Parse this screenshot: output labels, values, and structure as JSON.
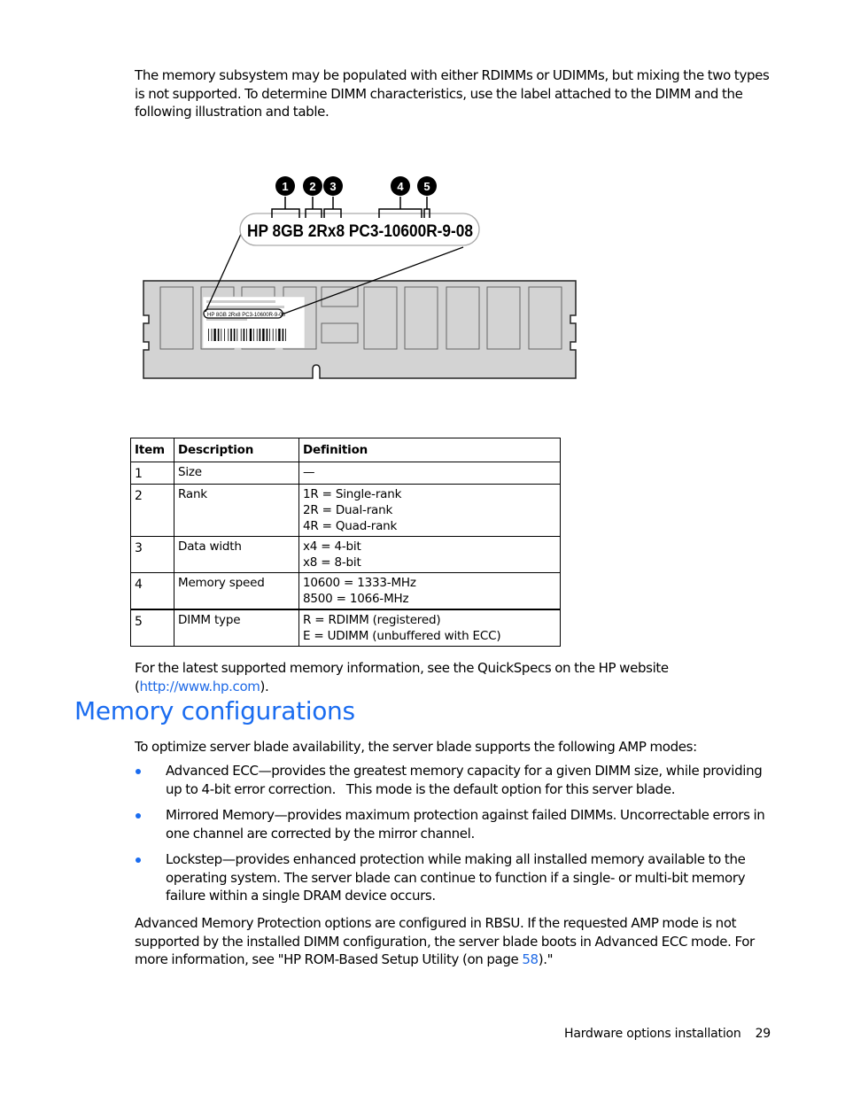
{
  "intro_paragraph": "The memory subsystem may be populated with either RDIMMs or UDIMMs, but mixing the two types is not supported. To determine DIMM characteristics, use the label attached to the DIMM and the following illustration and table.",
  "figure": {
    "label_text": "HP 8GB 2Rx8 PC3-10600R-9-08",
    "small_label_text": "HP 8GB 2Rx8 PC3-10600R-9-08",
    "callouts": [
      "1",
      "2",
      "3",
      "4",
      "5"
    ],
    "colors": {
      "module_fill": "#d3d3d3",
      "module_stroke": "#222222",
      "chip_stroke": "#666666",
      "callout_fill": "#000000",
      "callout_text": "#ffffff",
      "label_bubble_stroke": "#aaaaaa"
    }
  },
  "table": {
    "headers": [
      "Item",
      "Description",
      "Definition"
    ],
    "rows": [
      {
        "item": "1",
        "description": "Size",
        "definition": [
          "—"
        ]
      },
      {
        "item": "2",
        "description": "Rank",
        "definition": [
          "1R = Single-rank",
          "2R = Dual-rank",
          "4R = Quad-rank"
        ]
      },
      {
        "item": "3",
        "description": "Data width",
        "definition": [
          "x4 = 4-bit",
          "x8 = 8-bit"
        ]
      },
      {
        "item": "4",
        "description": "Memory speed",
        "definition": [
          "10600 = 1333-MHz",
          "8500 = 1066-MHz"
        ]
      },
      {
        "item": "5",
        "description": "DIMM type",
        "definition": [
          "R = RDIMM (registered)",
          "E = UDIMM (unbuffered with ECC)"
        ]
      }
    ]
  },
  "quickspecs_paragraph": {
    "before": "For the latest supported memory information, see the QuickSpecs on the HP website (",
    "link": "http://www.hp.com",
    "after": ")."
  },
  "section_heading": "Memory configurations",
  "amp_intro": "To optimize server blade availability, the server blade supports the following AMP modes:",
  "amp_modes": [
    "Advanced ECC—provides the greatest memory capacity for a given DIMM size, while providing up to 4-bit error correction.   This mode is the default option for this server blade.",
    "Mirrored Memory—provides maximum protection against failed DIMMs. Uncorrectable errors in one channel are corrected by the mirror channel.",
    "Lockstep—provides enhanced protection while making all installed memory available to the operating system. The server blade can continue to function if a single- or multi-bit memory failure within a single DRAM device occurs."
  ],
  "rbsu_paragraph": {
    "before": "Advanced Memory Protection options are configured in RBSU. If the requested AMP mode is not supported by the installed DIMM configuration, the server blade boots in Advanced ECC mode. For more information, see \"HP ROM-Based Setup Utility (on page ",
    "link": "58",
    "after": ").\""
  },
  "footer": {
    "section": "Hardware options installation",
    "page_number": "29"
  },
  "accent_color": "#1a6cf0",
  "link_color": "#1f6ae6"
}
